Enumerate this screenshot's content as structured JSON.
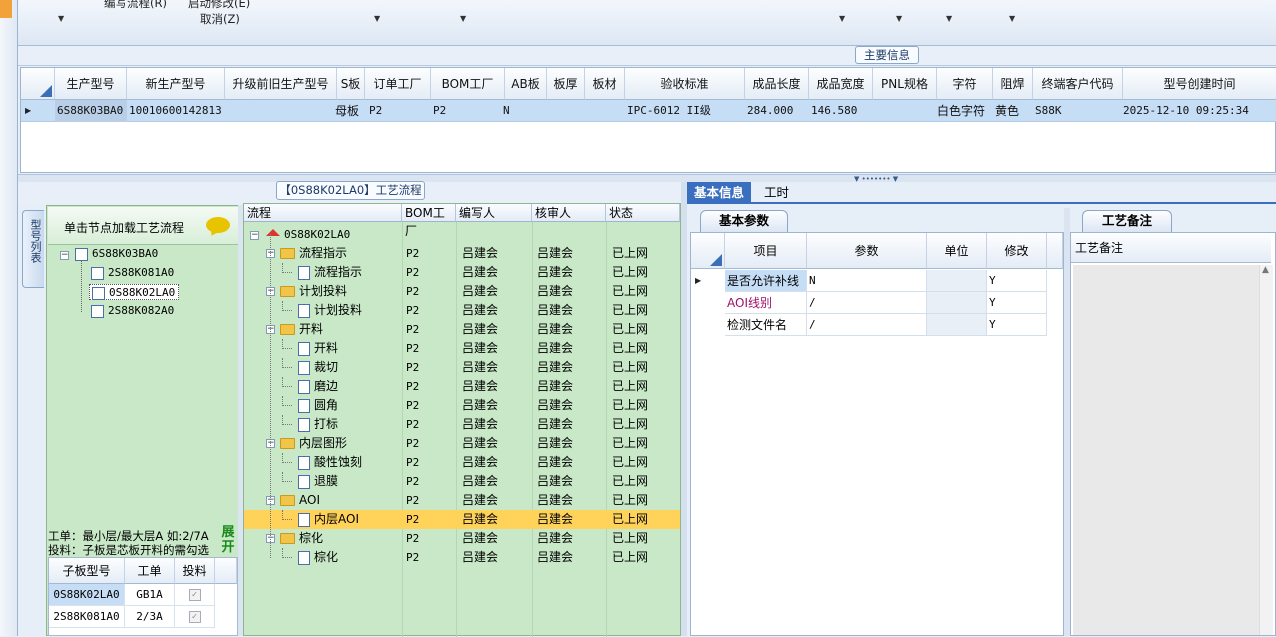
{
  "toolbar": {
    "item1": "编写流程(R)",
    "item2": "启动修改(E)",
    "item3": "取消(Z)"
  },
  "main_info": {
    "legend": "主要信息",
    "columns": [
      "生产型号",
      "新生产型号",
      "升级前旧生产型号",
      "S板",
      "订单工厂",
      "BOM工厂",
      "AB板",
      "板厚",
      "板材",
      "验收标准",
      "成品长度",
      "成品宽度",
      "PNL规格",
      "字符",
      "阻焊",
      "终端客户代码",
      "型号创建时间"
    ],
    "row": {
      "prod_model": "6S88K03BA0",
      "new_model": "10010600142813",
      "old_model": "",
      "s_board": "母板",
      "order_factory": "P2",
      "bom_factory": "P2",
      "ab_board": "N",
      "thickness": "",
      "material": "",
      "standard": "IPC-6012 II级",
      "length": "284.000",
      "width": "146.580",
      "pnl": "",
      "char": "白色字符",
      "mask": "黄色",
      "customer": "S88K",
      "created": "2025-12-10 09:25:34"
    }
  },
  "flow_panel": {
    "legend": "【0S88K02LA0】工艺流程",
    "vertical_tab": "型号列表",
    "click_hint": "单击节点加载工艺流程",
    "tree": [
      "6S88K03BA0",
      "2S88K081A0",
      "0S88K02LA0",
      "2S88K082A0"
    ],
    "note1": "工单：最小层/最大层A 如:2/7A",
    "note2": "投料：子板是芯板开料的需勾选",
    "expand_label": "展开",
    "sub_columns": [
      "子板型号",
      "工单",
      "投料"
    ],
    "sub_rows": [
      {
        "model": "0S88K02LA0",
        "order": "GB1A"
      },
      {
        "model": "2S88K081A0",
        "order": "2/3A"
      }
    ]
  },
  "flow_tree": {
    "columns": [
      "流程",
      "BOM工厂",
      "编写人",
      "核审人",
      "状态"
    ],
    "root": "0S88K02LA0",
    "rows": [
      {
        "name": "流程指示",
        "level": 1,
        "type": "folder",
        "bom": "P2",
        "writer": "吕建会",
        "reviewer": "吕建会",
        "status": "已上网"
      },
      {
        "name": "流程指示",
        "level": 2,
        "type": "doc",
        "bom": "P2",
        "writer": "吕建会",
        "reviewer": "吕建会",
        "status": "已上网"
      },
      {
        "name": "计划投料",
        "level": 1,
        "type": "folder",
        "bom": "P2",
        "writer": "吕建会",
        "reviewer": "吕建会",
        "status": "已上网"
      },
      {
        "name": "计划投料",
        "level": 2,
        "type": "doc",
        "bom": "P2",
        "writer": "吕建会",
        "reviewer": "吕建会",
        "status": "已上网"
      },
      {
        "name": "开料",
        "level": 1,
        "type": "folder",
        "bom": "P2",
        "writer": "吕建会",
        "reviewer": "吕建会",
        "status": "已上网"
      },
      {
        "name": "开料",
        "level": 2,
        "type": "doc",
        "bom": "P2",
        "writer": "吕建会",
        "reviewer": "吕建会",
        "status": "已上网"
      },
      {
        "name": "裁切",
        "level": 2,
        "type": "doc",
        "bom": "P2",
        "writer": "吕建会",
        "reviewer": "吕建会",
        "status": "已上网"
      },
      {
        "name": "磨边",
        "level": 2,
        "type": "doc",
        "bom": "P2",
        "writer": "吕建会",
        "reviewer": "吕建会",
        "status": "已上网"
      },
      {
        "name": "圆角",
        "level": 2,
        "type": "doc",
        "bom": "P2",
        "writer": "吕建会",
        "reviewer": "吕建会",
        "status": "已上网"
      },
      {
        "name": "打标",
        "level": 2,
        "type": "doc",
        "bom": "P2",
        "writer": "吕建会",
        "reviewer": "吕建会",
        "status": "已上网"
      },
      {
        "name": "内层图形",
        "level": 1,
        "type": "folder",
        "bom": "P2",
        "writer": "吕建会",
        "reviewer": "吕建会",
        "status": "已上网"
      },
      {
        "name": "酸性蚀刻",
        "level": 2,
        "type": "doc",
        "bom": "P2",
        "writer": "吕建会",
        "reviewer": "吕建会",
        "status": "已上网"
      },
      {
        "name": "退膜",
        "level": 2,
        "type": "doc",
        "bom": "P2",
        "writer": "吕建会",
        "reviewer": "吕建会",
        "status": "已上网"
      },
      {
        "name": "AOI",
        "level": 1,
        "type": "folder",
        "bom": "P2",
        "writer": "吕建会",
        "reviewer": "吕建会",
        "status": "已上网"
      },
      {
        "name": "内层AOI",
        "level": 2,
        "type": "doc",
        "bom": "P2",
        "writer": "吕建会",
        "reviewer": "吕建会",
        "status": "已上网",
        "selected": true
      },
      {
        "name": "棕化",
        "level": 1,
        "type": "folder",
        "bom": "P2",
        "writer": "吕建会",
        "reviewer": "吕建会",
        "status": "已上网"
      },
      {
        "name": "棕化",
        "level": 2,
        "type": "doc",
        "bom": "P2",
        "writer": "吕建会",
        "reviewer": "吕建会",
        "status": "已上网"
      }
    ]
  },
  "right_panel": {
    "tabs": [
      "基本信息",
      "工时"
    ],
    "basic_params_tab": "基本参数",
    "process_notes_tab": "工艺备注",
    "param_columns": [
      "项目",
      "参数",
      "单位",
      "修改"
    ],
    "params": [
      {
        "item": "是否允许补线",
        "value": "N",
        "unit": "",
        "modify": "Y",
        "color": "#000000"
      },
      {
        "item": "AOI线别",
        "value": "/",
        "unit": "",
        "modify": "Y",
        "color": "#a0106a"
      },
      {
        "item": "检测文件名",
        "value": "/",
        "unit": "",
        "modify": "Y",
        "color": "#000000"
      }
    ],
    "notes_column": "工艺备注"
  }
}
